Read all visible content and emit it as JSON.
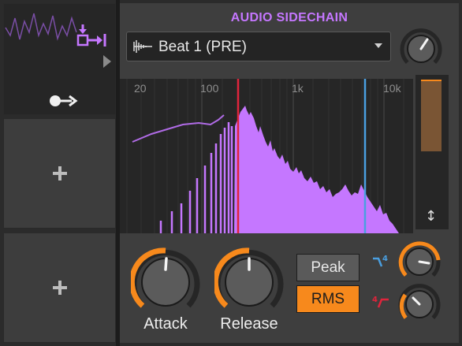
{
  "device": {
    "title": "AUDIO SIDECHAIN",
    "source": {
      "label": "Beat 1 (PRE)",
      "icon": "waveform-icon"
    },
    "frequency_ticks": [
      "20",
      "100",
      "1k",
      "10k"
    ],
    "knobs": {
      "attack_label": "Attack",
      "release_label": "Release"
    },
    "mode": {
      "peak_label": "Peak",
      "rms_label": "RMS",
      "selected": "RMS"
    },
    "meter_level": 0.65,
    "filter_markers": {
      "low_cut_hz": 250,
      "high_cut_hz": 6000
    },
    "colors": {
      "accent": "#c577ff",
      "orange": "#f7891c",
      "red": "#e0243c",
      "blue": "#4a9fe0"
    }
  },
  "slots": {
    "slot1_icons": [
      "modulator-output-icon",
      "play-arrow-icon",
      "key-route-icon"
    ],
    "slot2_icon": "add-icon",
    "slot3_icon": "add-icon"
  }
}
